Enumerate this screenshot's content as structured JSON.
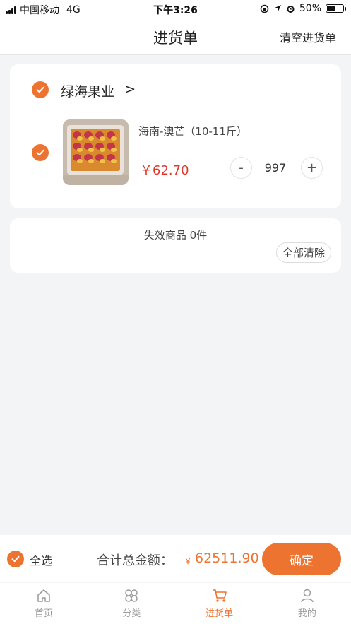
{
  "status_bar": {
    "carrier": "中国移动",
    "network": "4G",
    "time": "下午3:26",
    "battery": "50%",
    "battery_level": 0.5
  },
  "header": {
    "title": "进货单",
    "clear_label": "清空进货单"
  },
  "shop": {
    "name": "绿海果业",
    "arrow": ">",
    "item": {
      "name": "海南-澳芒（10-11斤）",
      "price": "￥62.70",
      "quantity": "997",
      "minus": "-",
      "plus": "+"
    }
  },
  "invalid": {
    "text": "失效商品 0件",
    "clear_label": "全部清除"
  },
  "checkout": {
    "select_all": "全选",
    "total_label": "合计总金额：",
    "currency": "￥",
    "amount": "62511.90",
    "confirm": "确定"
  },
  "tabs": [
    {
      "label": "首页",
      "icon": "home-icon",
      "active": false
    },
    {
      "label": "分类",
      "icon": "category-icon",
      "active": false
    },
    {
      "label": "进货单",
      "icon": "cart-icon",
      "active": true
    },
    {
      "label": "我的",
      "icon": "user-icon",
      "active": false
    }
  ],
  "colors": {
    "accent": "#ed7331",
    "price": "#e0362c",
    "background": "#f3f4f6"
  }
}
